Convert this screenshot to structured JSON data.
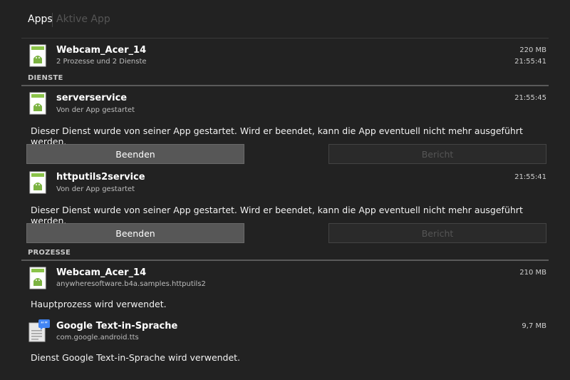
{
  "tabs": {
    "apps": "Apps",
    "active_app": "Aktive App"
  },
  "app": {
    "name": "Webcam_Acer_14",
    "summary": "2 Prozesse und 2 Dienste",
    "size": "220 MB",
    "time": "21:55:41",
    "icon": "android-app-icon"
  },
  "services_section": "DIENSTE",
  "services": [
    {
      "name": "serverservice",
      "subtitle": "Von der App gestartet",
      "time": "21:55:45",
      "description": "Dieser Dienst wurde von seiner App gestartet. Wird er beendet, kann die App eventuell nicht mehr ausgeführt werden.",
      "stop_label": "Beenden",
      "report_label": "Bericht"
    },
    {
      "name": "httputils2service",
      "subtitle": "Von der App gestartet",
      "time": "21:55:41",
      "description": "Dieser Dienst wurde von seiner App gestartet. Wird er beendet, kann die App eventuell nicht mehr ausgeführt werden.",
      "stop_label": "Beenden",
      "report_label": "Bericht"
    }
  ],
  "processes_section": "PROZESSE",
  "processes": [
    {
      "name": "Webcam_Acer_14",
      "package": "anywheresoftware.b4a.samples.httputils2",
      "size": "210 MB",
      "description": "Hauptprozess wird verwendet.",
      "icon": "android-app-icon"
    },
    {
      "name": "Google Text-in-Sprache",
      "package": "com.google.android.tts",
      "size": "9,7 MB",
      "description": "Dienst Google Text-in-Sprache wird verwendet.",
      "icon": "google-tts-icon"
    }
  ],
  "colors": {
    "background": "#222222",
    "android_green": "#8bc34a",
    "button_active": "#575757",
    "button_disabled": "#2a2a2a"
  }
}
